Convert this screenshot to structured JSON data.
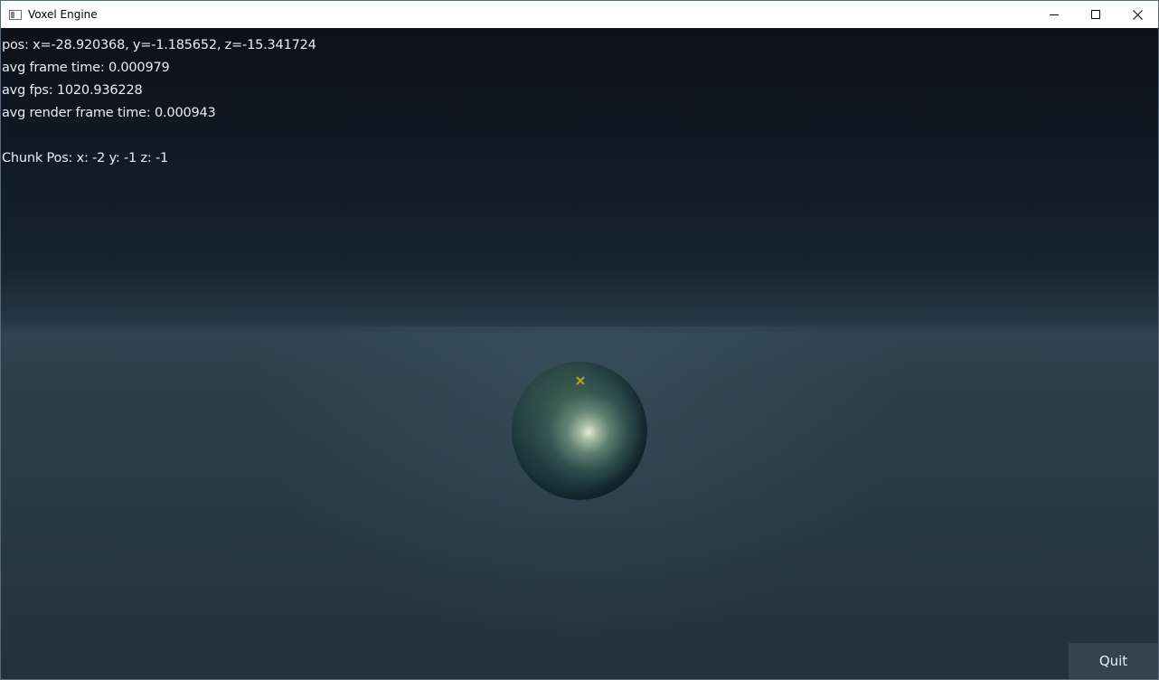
{
  "window": {
    "title": "Voxel Engine",
    "icons": {
      "app": "app-window-icon",
      "minimize": "minimize-icon",
      "maximize": "maximize-icon",
      "close": "close-icon"
    }
  },
  "hud": {
    "pos": "pos: x=-28.920368, y=-1.185652, z=-15.341724",
    "avg_frame_time": "avg frame time: 0.000979",
    "avg_fps": "avg fps: 1020.936228",
    "avg_render_frame_time": "avg render frame time: 0.000943",
    "chunk_pos": "Chunk Pos: x: -2 y: -1 z: -1"
  },
  "scene": {
    "crosshair_icon": "crosshair-icon",
    "crosshair_color": "#b5a21e"
  },
  "buttons": {
    "quit_label": "Quit"
  },
  "colors": {
    "hud_text": "#e9eef2",
    "sky_top": "#0c1119",
    "horizon": "#2f4350",
    "ground": "#22323d",
    "quit_bg": "#33444f"
  }
}
